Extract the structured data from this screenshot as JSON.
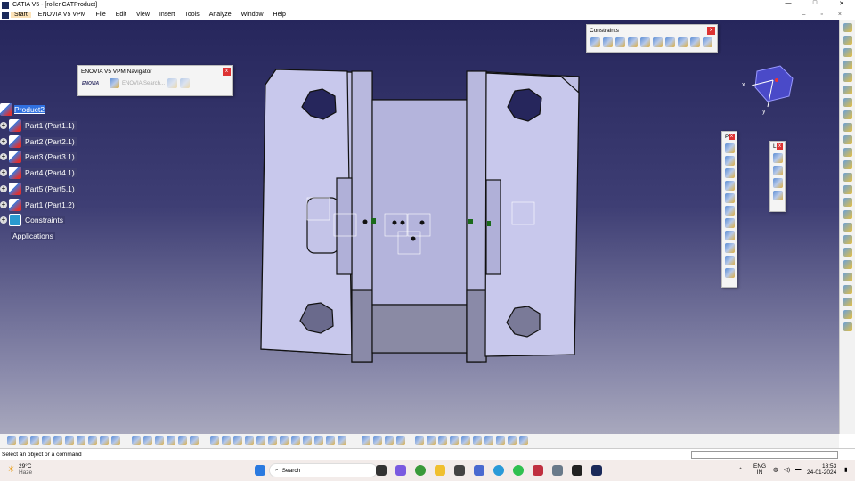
{
  "window": {
    "title": "CATIA V5 - [roller.CATProduct]",
    "minimize": "—",
    "maximize": "□",
    "close": "✕"
  },
  "menu": [
    "Start",
    "ENOVIA V5 VPM",
    "File",
    "Edit",
    "View",
    "Insert",
    "Tools",
    "Analyze",
    "Window",
    "Help"
  ],
  "tree": {
    "root": "Product2",
    "items": [
      "Part1 (Part1.1)",
      "Part2 (Part2.1)",
      "Part3 (Part3.1)",
      "Part4 (Part4.1)",
      "Part5 (Part5.1)",
      "Part1 (Part1.2)",
      "Constraints"
    ],
    "applications": "Applications"
  },
  "enovia_panel": {
    "title": "ENOVIA V5 VPM Navigator",
    "logo": "ENOVIA",
    "search": "ENOVIA Search..."
  },
  "constraints_panel": {
    "title": "Constraints"
  },
  "small_panels": [
    "P",
    "L"
  ],
  "close_glyph": "x",
  "compass": {
    "x": "x",
    "y": "y"
  },
  "status": {
    "message": "Select an object or a command"
  },
  "taskbar": {
    "weather_temp": "29°C",
    "weather_desc": "Haze",
    "search": "Search",
    "lang1": "ENG",
    "lang2": "IN",
    "time": "18:53",
    "date": "24-01-2024"
  }
}
